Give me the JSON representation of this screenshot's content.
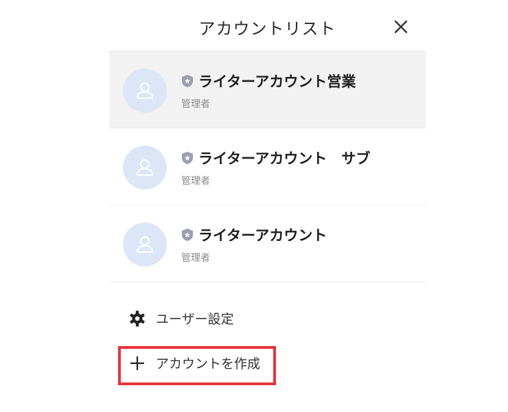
{
  "header": {
    "title": "アカウントリスト",
    "close_icon": "close-icon"
  },
  "accounts": [
    {
      "name": "ライターアカウント営業",
      "role": "管理者",
      "selected": true,
      "badge_icon": "shield-icon",
      "avatar_icon": "user-icon"
    },
    {
      "name": "ライターアカウント　サブ",
      "role": "管理者",
      "selected": false,
      "badge_icon": "shield-icon",
      "avatar_icon": "user-icon"
    },
    {
      "name": "ライターアカウント",
      "role": "管理者",
      "selected": false,
      "badge_icon": "shield-icon",
      "avatar_icon": "user-icon"
    }
  ],
  "menu": {
    "settings_label": "ユーザー設定",
    "settings_icon": "gear-icon",
    "create_label": "アカウントを作成",
    "create_icon": "plus-icon"
  },
  "colors": {
    "avatar_bg": "#dde6f6",
    "avatar_icon": "#ffffff",
    "selected_bg": "#f2f2f2",
    "badge": "#9a9fae",
    "highlight": "#e8333a"
  }
}
